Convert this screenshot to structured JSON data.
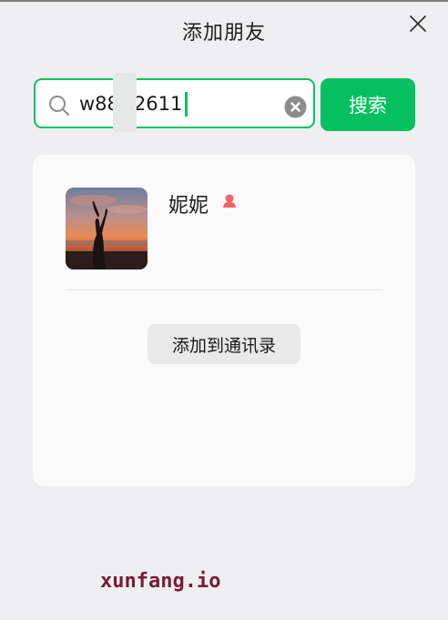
{
  "dialog": {
    "title": "添加朋友"
  },
  "search": {
    "value": "w88",
    "value_rest": "2611",
    "clear_icon": "clear-circle-icon",
    "search_icon": "magnifier-icon",
    "button_label": "搜索"
  },
  "result": {
    "name": "妮妮",
    "gender": "female",
    "add_button_label": "添加到通讯录"
  },
  "watermark": {
    "text": "xunfang.io"
  },
  "colors": {
    "accent": "#07c160",
    "background": "#efeff1",
    "card": "#fafafa",
    "secondary_button": "#e9e9e9",
    "gender_female": "#f06565",
    "watermark": "#7b1b38"
  }
}
